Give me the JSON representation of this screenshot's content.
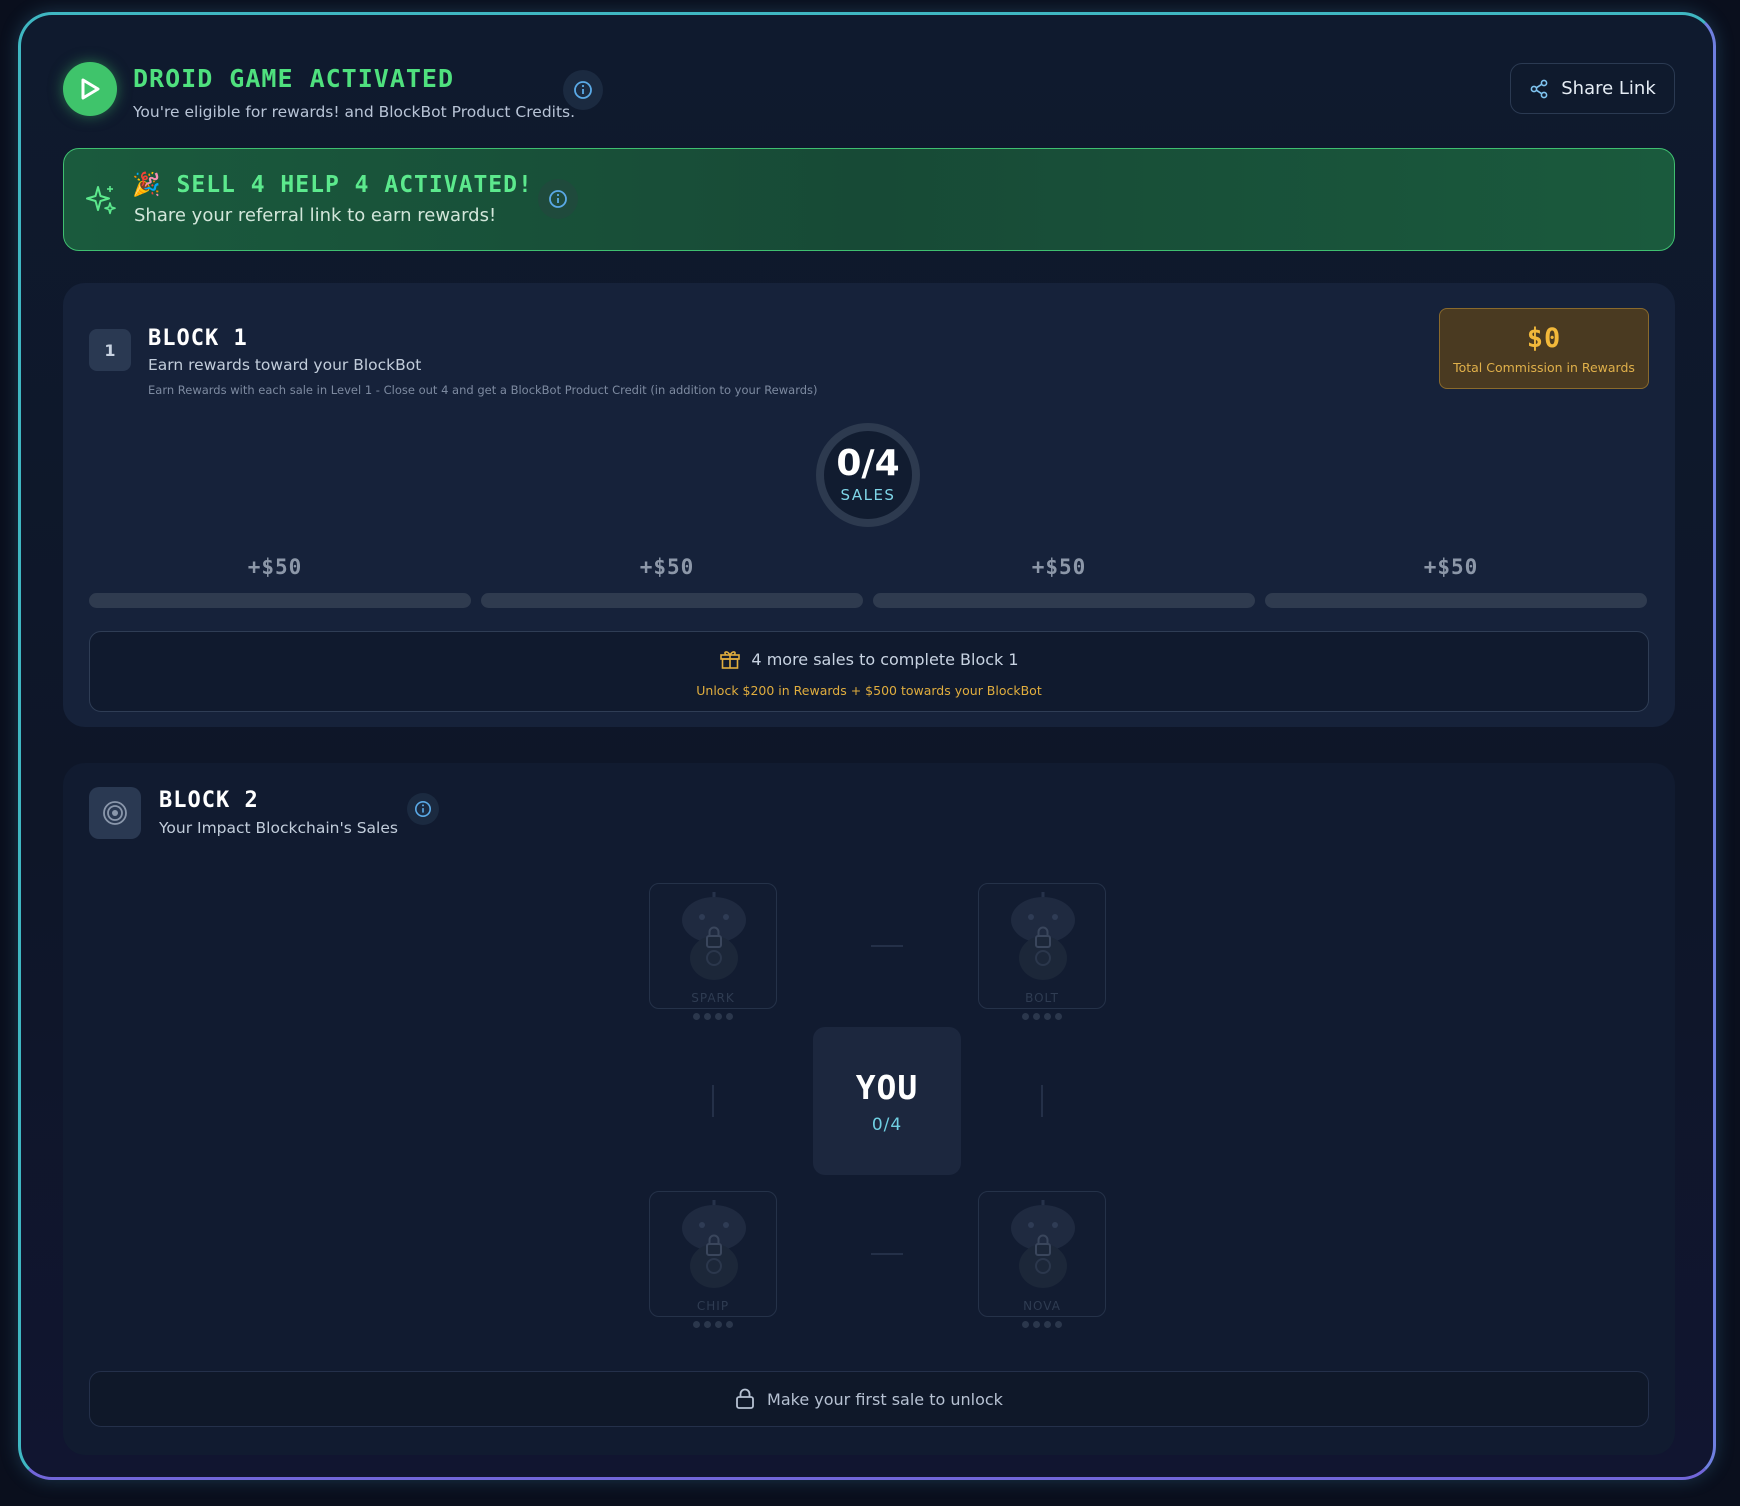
{
  "header": {
    "title": "DROID GAME ACTIVATED",
    "subtitle": "You're eligible for rewards! and BlockBot Product Credits.",
    "share_label": "Share Link"
  },
  "banner": {
    "emoji": "🎉",
    "title": "SELL 4 HELP 4 ACTIVATED!",
    "subtitle": "Share your referral link to earn rewards!"
  },
  "block1": {
    "badge": "1",
    "title": "BLOCK 1",
    "subtitle": "Earn rewards toward your BlockBot",
    "note": "Earn Rewards with each sale in Level 1 - Close out 4 and get a BlockBot Product Credit (in addition to your Rewards)",
    "commission_amount": "$0",
    "commission_label": "Total Commission in Rewards",
    "sales_count": "0/4",
    "sales_label": "SALES",
    "rewards": [
      {
        "label": "+$50",
        "progress": 0
      },
      {
        "label": "+$50",
        "progress": 0
      },
      {
        "label": "+$50",
        "progress": 0
      },
      {
        "label": "+$50",
        "progress": 0
      }
    ],
    "info_line1": "4 more sales to complete Block 1",
    "info_line2": "Unlock $200 in Rewards + $500 towards your BlockBot"
  },
  "block2": {
    "title": "BLOCK 2",
    "subtitle": "Your Impact Blockchain's Sales",
    "droids": [
      {
        "name": "SPARK",
        "locked": true
      },
      {
        "name": "BOLT",
        "locked": true
      },
      {
        "name": "CHIP",
        "locked": true
      },
      {
        "name": "NOVA",
        "locked": true
      }
    ],
    "you_label": "YOU",
    "you_count": "0/4",
    "unlock_text": "Make your first sale to unlock"
  },
  "colors": {
    "accent_green": "#3fc46b",
    "title_green": "#4fe07e",
    "gold": "#f2b83a",
    "cyan": "#6fcfe2",
    "frame_border": "#3fb7c2"
  },
  "icons": [
    "play-icon",
    "info-icon",
    "share-icon",
    "sparkles-icon",
    "gift-icon",
    "target-icon",
    "robot-icon",
    "lock-icon"
  ]
}
